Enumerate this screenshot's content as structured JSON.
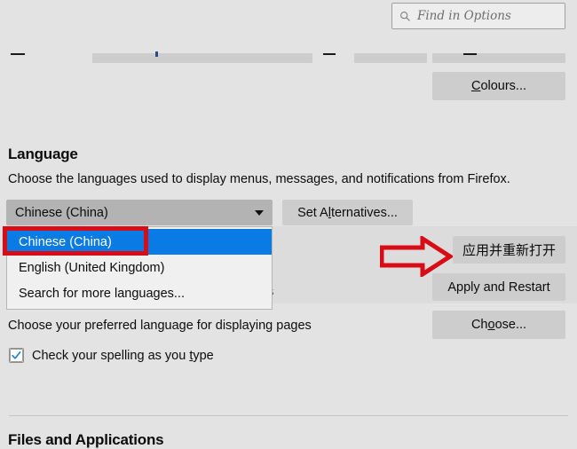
{
  "search": {
    "placeholder": "Find in Options",
    "icon": "search-icon"
  },
  "top_partial": {
    "colours_button": "Colours..."
  },
  "language_section": {
    "heading": "Language",
    "description": "Choose the languages used to display menus, messages, and notifications from Firefox.",
    "select": {
      "value": "Chinese (China)",
      "caret_icon": "chevron-down-icon"
    },
    "set_alternatives_button": "Set Alternatives...",
    "dropdown": {
      "open": true,
      "items": [
        {
          "label": "Chinese (China)",
          "selected": true
        },
        {
          "label": "English (United Kingdom)",
          "selected": false
        },
        {
          "label": "Search for more languages...",
          "selected": false
        }
      ]
    },
    "obscured_text_fragment": "s",
    "apply_restart_chinese_button": "应用并重新打开",
    "apply_restart_button": "Apply and Restart",
    "annotations": {
      "highlight_color": "#d90b14",
      "arrow_color": "#d90b14",
      "arrow_icon": "arrow-right-icon",
      "highlight_target": "Chinese (China)",
      "arrow_target": "应用并重新打开"
    }
  },
  "pages_language": {
    "label": "Choose your preferred language for displaying pages",
    "choose_button": "Choose..."
  },
  "spellcheck": {
    "label": "Check your spelling as you type",
    "checked": true
  },
  "next_section": {
    "heading": "Files and Applications"
  },
  "colors": {
    "background": "#e3e3e3",
    "button": "#cdcdcd",
    "select": "#b3b3b3",
    "selected_item": "#0a7ae5",
    "annotation_red": "#d90b14",
    "panel": "#dcdcdc"
  }
}
